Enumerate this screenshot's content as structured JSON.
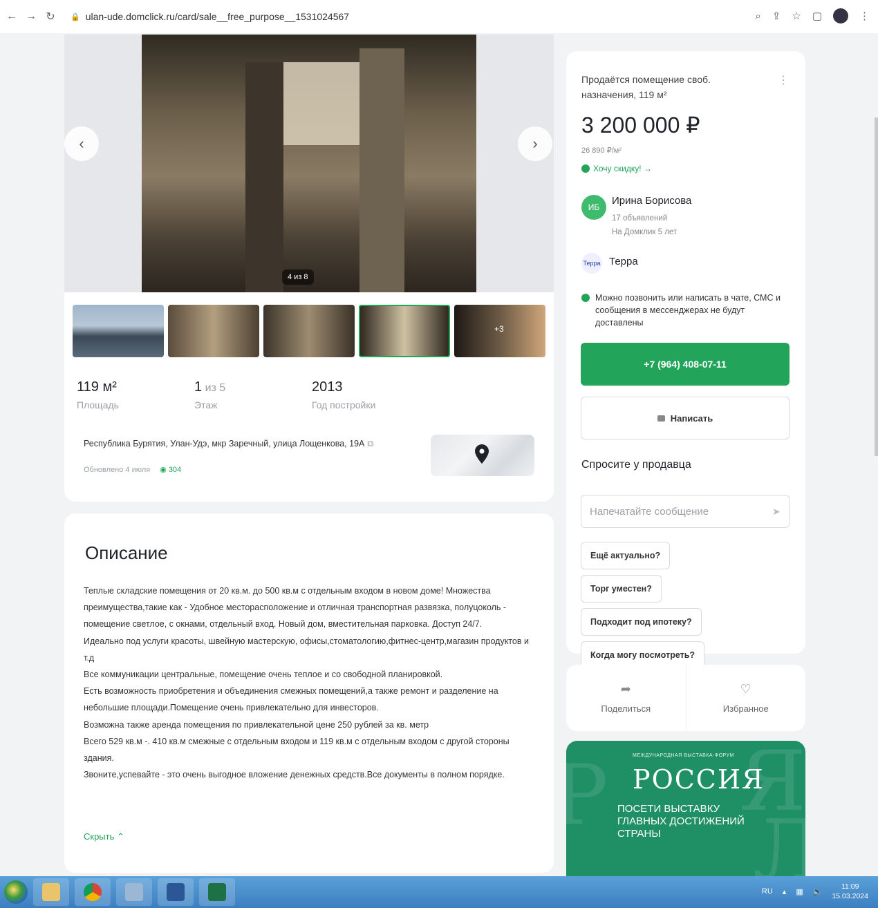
{
  "browser": {
    "url": "ulan-ude.domclick.ru/card/sale__free_purpose__1531024567"
  },
  "gallery": {
    "counter": "4 из 8",
    "thumb_more": "+3"
  },
  "stats": [
    {
      "value": "119 м²",
      "value_muted": "",
      "label": "Площадь"
    },
    {
      "value": "1",
      "value_muted": " из 5",
      "label": "Этаж"
    },
    {
      "value": "2013",
      "value_muted": "",
      "label": "Год постройки"
    }
  ],
  "address": "Республика Бурятия, Улан-Удэ, мкр Заречный, улица Лощенкова, 19А",
  "updated": "Обновлено 4 июля",
  "views": "304",
  "description": {
    "title": "Описание",
    "paragraphs": [
      "Теплые складские помещения от 20 кв.м. до 500 кв.м с отдельным входом в новом доме! Множества преимущества,такие как - Удобное месторасположение и отличная транспортная развязка, полуцоколь - помещение светлое, с окнами, отдельный вход. Новый дом, вместительная парковка. Доступ 24/7.",
      "Идеально под услуги красоты, швейную мастерскую, офисы,стоматологию,фитнес-центр,магазин продуктов и т.д",
      "Все коммуникации центральные, помещение очень теплое и со свободной планировкой.",
      "Есть возможность приобретения и объединения смежных помещений,а также ремонт и разделение на небольшие площади.Помещение очень привлекательно для инвесторов.",
      "Возможна также аренда помещения по привлекательной цене 250 рублей за кв. метр",
      "Всего 529 кв.м -. 410 кв.м смежные с отдельным входом и 119 кв.м с отдельным входом с другой стороны здания.",
      "Звоните,успевайте - это очень выгодное вложение денежных средств.Все документы в полном порядке."
    ],
    "hide_label": "Скрыть"
  },
  "sidebar": {
    "title": "Продаётся помещение своб. назначения, 119 м²",
    "price": "3 200 000 ₽",
    "price_per_m": "26 890 ₽/м²",
    "discount": "Хочу скидку! →",
    "seller": {
      "initials": "ИБ",
      "name": "Ирина Борисова",
      "ads": "17 объявлений",
      "since": "На Домклик 5 лет"
    },
    "agency": {
      "logo": "Терра",
      "name": "Терра"
    },
    "notice": "Можно позвонить или написать в чате, СМС и сообщения в мессенджерах не будут доставлены",
    "phone": "+7 (964) 408-07-11",
    "write": "Написать",
    "ask_title": "Спросите у продавца",
    "message_placeholder": "Напечатайте сообщение",
    "chips": [
      "Ещё актуально?",
      "Торг уместен?",
      "Подходит под ипотеку?",
      "Когда могу посмотреть?"
    ]
  },
  "share": {
    "share_label": "Поделиться",
    "fav_label": "Избранное"
  },
  "banner": {
    "top": "МЕЖДУНАРОДНАЯ ВЫСТАВКА-ФОРУМ",
    "logo": "РОССИЯ",
    "sub": "ПОСЕТИ ВЫСТАВКУ ГЛАВНЫХ ДОСТИЖЕНИЙ СТРАНЫ"
  },
  "taskbar": {
    "lang": "RU",
    "time": "11:09",
    "date": "15.03.2024"
  }
}
